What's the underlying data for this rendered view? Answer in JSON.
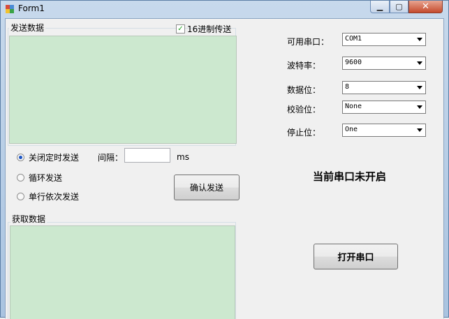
{
  "window": {
    "title": "Form1",
    "min_symbol": "▁",
    "max_symbol": "▢",
    "close_symbol": "✕"
  },
  "send_group": {
    "title": "发送数据",
    "hex_checkbox": {
      "label": "16进制传送",
      "checked": true,
      "mark": "✓"
    }
  },
  "timer": {
    "options": [
      {
        "label": "关闭定时发送",
        "selected": true
      },
      {
        "label": "循环发送",
        "selected": false
      },
      {
        "label": "单行依次发送",
        "selected": false
      }
    ],
    "interval_label": "间隔：",
    "interval_value": "",
    "unit": "ms"
  },
  "confirm_send_label": "确认发送",
  "receive_group": {
    "title": "获取数据"
  },
  "serial": {
    "port_label": "可用串口：",
    "port_value": "COM1",
    "baud_label": "波特率：",
    "baud_value": "9600",
    "databits_label": "数据位：",
    "databits_value": "8",
    "parity_label": "校验位：",
    "parity_value": "None",
    "stopbits_label": "停止位：",
    "stopbits_value": "One"
  },
  "status_text": "当前串口未开启",
  "open_port_label": "打开串口",
  "colors": {
    "textarea_bg": "#cce8cf",
    "title_bar": "#a9c3e0",
    "close_button": "#c44a2c"
  }
}
